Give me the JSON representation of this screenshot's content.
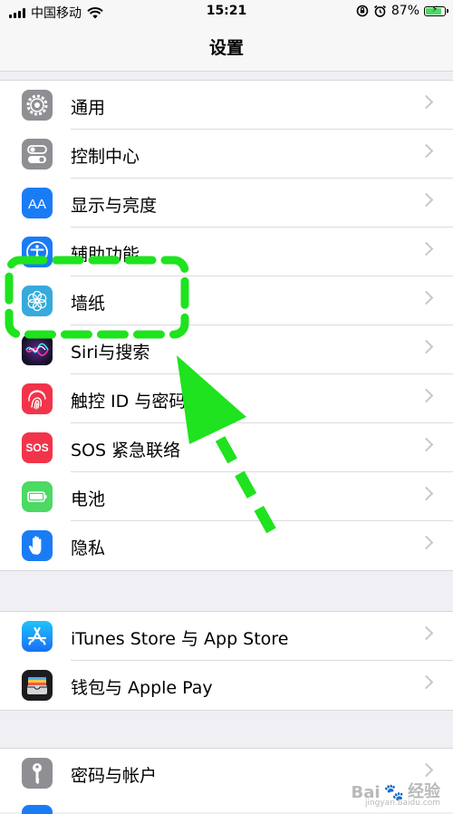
{
  "status_bar": {
    "carrier": "中国移动",
    "time": "15:21",
    "battery_percent": "87%",
    "battery_level": 0.87
  },
  "nav": {
    "title": "设置"
  },
  "groups": [
    {
      "items": [
        {
          "label": "通用",
          "icon": "gear-icon",
          "color": "#8e8e93"
        },
        {
          "label": "控制中心",
          "icon": "switches-icon",
          "color": "#8e8e93"
        },
        {
          "label": "显示与亮度",
          "icon": "text-size-icon",
          "color": "#1a7cf5"
        },
        {
          "label": "辅助功能",
          "icon": "accessibility-icon",
          "color": "#1a7cf5"
        },
        {
          "label": "墙纸",
          "icon": "flower-icon",
          "color": "#36aadc"
        },
        {
          "label": "Siri与搜索",
          "icon": "siri-icon",
          "color": "#1c1c1e"
        },
        {
          "label": "触控 ID 与密码",
          "icon": "fingerprint-icon",
          "color": "#f2344a"
        },
        {
          "label": "SOS 紧急联络",
          "icon": "sos-icon",
          "color": "#f2344a"
        },
        {
          "label": "电池",
          "icon": "battery-icon",
          "color": "#4cd964"
        },
        {
          "label": "隐私",
          "icon": "hand-icon",
          "color": "#1a7cf5"
        }
      ]
    },
    {
      "items": [
        {
          "label": "iTunes Store 与 App Store",
          "icon": "app-store-icon",
          "color": "#1a8cf5"
        },
        {
          "label": "钱包与 Apple Pay",
          "icon": "wallet-icon",
          "color": "#1c1c1e"
        }
      ]
    },
    {
      "items": [
        {
          "label": "密码与帐户",
          "icon": "key-icon",
          "color": "#8e8e93"
        }
      ]
    }
  ],
  "icons": {
    "sos_text": "SOS"
  },
  "annotation": {
    "color": "#1ee31e"
  },
  "watermark": {
    "brand": "Bai",
    "suffix": "经验",
    "url": "jingyan.baidu.com"
  }
}
